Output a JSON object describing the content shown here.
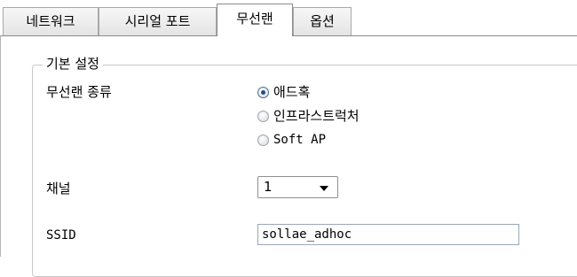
{
  "tabs": [
    {
      "label": "네트워크"
    },
    {
      "label": "시리얼 포트"
    },
    {
      "label": "무선랜",
      "active": true
    },
    {
      "label": "옵션"
    }
  ],
  "group": {
    "title": "기본 설정"
  },
  "wireless_type": {
    "label": "무선랜 종류",
    "options": [
      "애드혹",
      "인프라스트럭처",
      "Soft AP"
    ],
    "selected": "애드혹"
  },
  "channel": {
    "label": "채널",
    "value": "1"
  },
  "ssid": {
    "label": "SSID",
    "value": "sollae_adhoc"
  }
}
